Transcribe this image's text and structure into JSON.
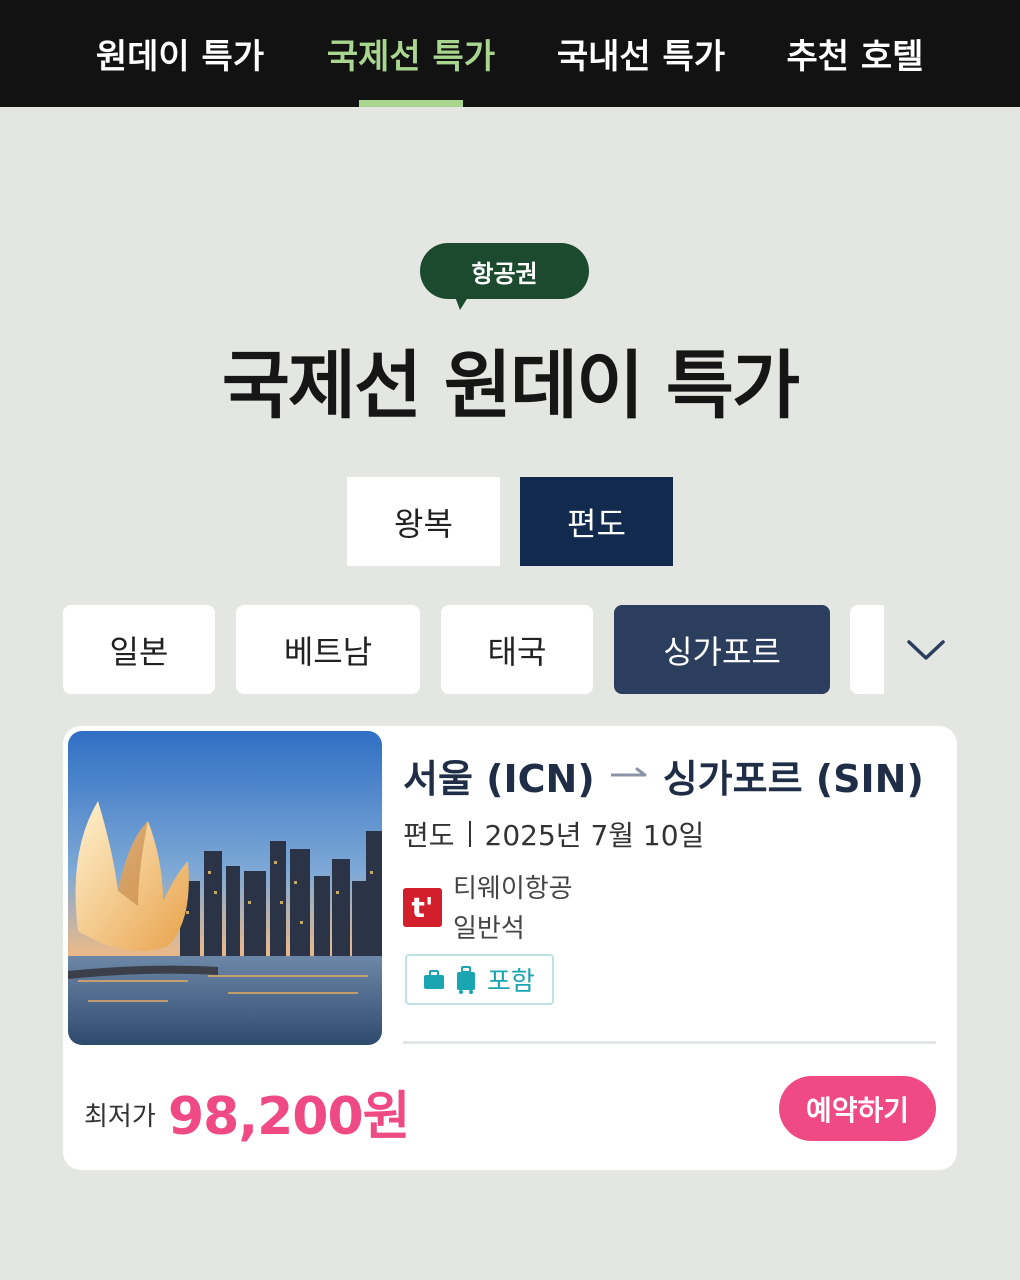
{
  "nav": {
    "tabs": [
      {
        "label": "원데이 특가"
      },
      {
        "label": "국제선 특가"
      },
      {
        "label": "국내선 특가"
      },
      {
        "label": "추천 호텔"
      }
    ],
    "active_index": 1,
    "active_color": "#a8d68f"
  },
  "header": {
    "badge": "항공권",
    "title": "국제선 원데이 특가"
  },
  "trip_type": {
    "options": [
      {
        "label": "왕복"
      },
      {
        "label": "편도"
      }
    ],
    "selected": "편도"
  },
  "countries": {
    "chips": [
      {
        "label": "일본"
      },
      {
        "label": "베트남"
      },
      {
        "label": "태국"
      },
      {
        "label": "싱가포르"
      }
    ],
    "selected": "싱가포르",
    "expand_icon": "chevron-down-icon"
  },
  "deal": {
    "route": {
      "origin": "서울 (ICN)",
      "destination": "싱가포르 (SIN)"
    },
    "trip_type": "편도",
    "date": "2025년 7월 10일",
    "airline": {
      "logo_text": "t'",
      "name": "티웨이항공",
      "seat_class": "일반석"
    },
    "baggage": {
      "label": "포함",
      "icons": [
        "carry-on-bag-icon",
        "suitcase-icon"
      ]
    },
    "price_label": "최저가",
    "price": "98,200원",
    "book_label": "예약하기",
    "accent_color": "#f04a85"
  }
}
